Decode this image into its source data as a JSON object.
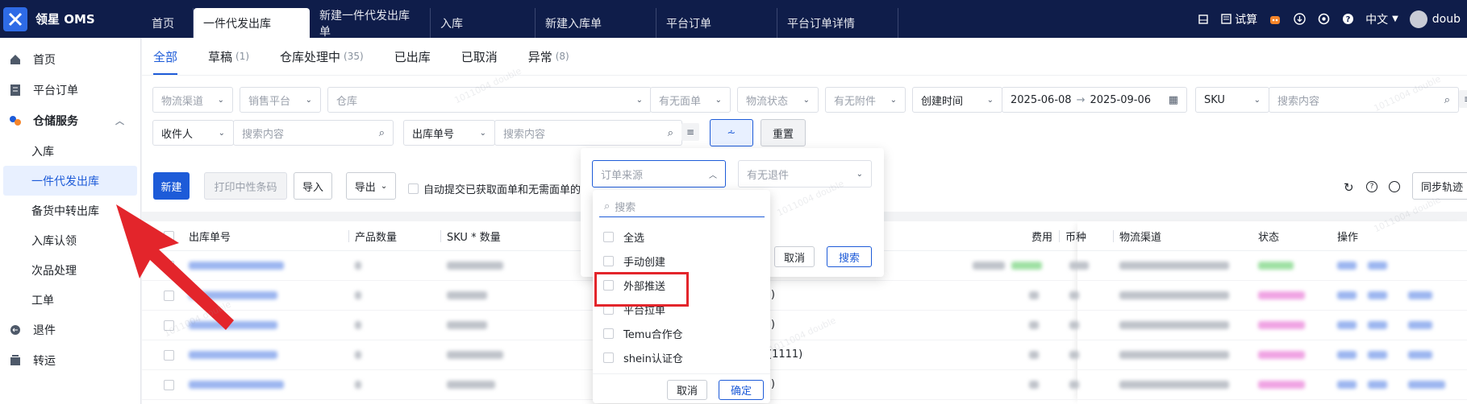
{
  "topbar": {
    "logo_text": "领星 OMS",
    "tabs": [
      "首页",
      "一件代发出库",
      "新建一件代发出库单",
      "入库",
      "新建入库单",
      "平台订单",
      "平台订单详情"
    ],
    "trial_label": "试算",
    "language_label": "中文",
    "user_label": "doub"
  },
  "sidebar": {
    "items": [
      {
        "label": "首页",
        "icon": "home-icon"
      },
      {
        "label": "平台订单",
        "icon": "document-icon"
      },
      {
        "label": "仓储服务",
        "icon": "warehouse-icon"
      }
    ],
    "sub_items": [
      "入库",
      "一件代发出库",
      "备货中转出库",
      "入库认领",
      "次品处理",
      "工单"
    ],
    "bottom_items": [
      {
        "label": "退件",
        "icon": "return-icon"
      },
      {
        "label": "转运",
        "icon": "transfer-icon"
      }
    ]
  },
  "status_tabs": [
    {
      "label": "全部",
      "count": ""
    },
    {
      "label": "草稿",
      "count": "(1)"
    },
    {
      "label": "仓库处理中",
      "count": "(35)"
    },
    {
      "label": "已出库",
      "count": ""
    },
    {
      "label": "已取消",
      "count": ""
    },
    {
      "label": "异常",
      "count": "(8)"
    }
  ],
  "filters": {
    "logistics_channel": "物流渠道",
    "sales_platform": "销售平台",
    "warehouse": "仓库",
    "has_label": "有无面单",
    "logistics_status": "物流状态",
    "has_attachment": "有无附件",
    "time_type": "创建时间",
    "date_start": "2025-06-08",
    "date_end": "2025-09-06",
    "sku_type": "SKU",
    "search_placeholder": "搜索内容",
    "recipient_type": "收件人",
    "recipient_placeholder": "搜索内容",
    "order_no_type": "出库单号",
    "order_no_placeholder": "搜索内容",
    "reset_label": "重置"
  },
  "toolbar": {
    "new_label": "新建",
    "print_label": "打印中性条码",
    "import_label": "导入",
    "export_label": "导出",
    "auto_submit_label": "自动提交已获取面单和无需面单的",
    "sync_label": "同步轨迹"
  },
  "table": {
    "headers": [
      "出库单号",
      "产品数量",
      "SKU * 数量",
      "费用",
      "币种",
      "物流渠道",
      "状态",
      "操作"
    ],
    "row_fragments": [
      "J)",
      "J)",
      "(1111)",
      "J)"
    ]
  },
  "advanced_popover": {
    "order_source_placeholder": "订单来源",
    "has_return_placeholder": "有无退件",
    "cancel_label": "取消",
    "search_label": "搜索"
  },
  "source_dropdown": {
    "search_placeholder": "搜索",
    "options": [
      "全选",
      "手动创建",
      "外部推送",
      "平台拉单",
      "Temu合作仓",
      "shein认证仓"
    ],
    "cancel_label": "取消",
    "confirm_label": "确定"
  },
  "watermark": "1011004 double",
  "colors": {
    "brand": "#1d5bd8",
    "topbar": "#0f1d4a",
    "highlight": "#e3252b"
  }
}
